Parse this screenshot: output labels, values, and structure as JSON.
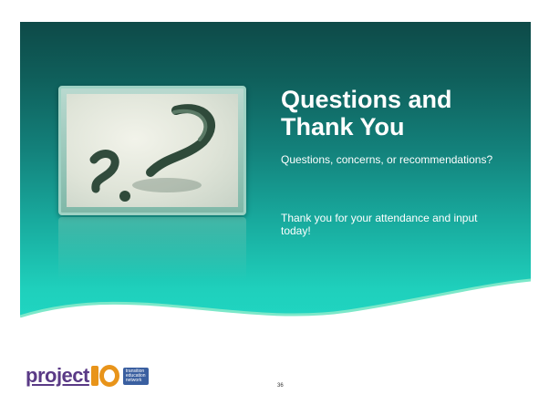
{
  "slide": {
    "title": "Questions and Thank You",
    "question_text": "Questions, concerns, or recommendations?",
    "thanks_text": "Thank you for your attendance and input today!",
    "page_number": "36"
  },
  "logo": {
    "word": "project",
    "number_one": "1",
    "number_zero": "0",
    "tagline": [
      "transition",
      "education",
      "network"
    ]
  },
  "colors": {
    "panel_top": "#0e4a48",
    "panel_bottom": "#20d8c4",
    "logo_purple": "#5a3a86",
    "logo_orange": "#e8941a",
    "logo_blue": "#3a5fa0"
  },
  "icons": {
    "question_mark_image": "question-mark-icon"
  }
}
